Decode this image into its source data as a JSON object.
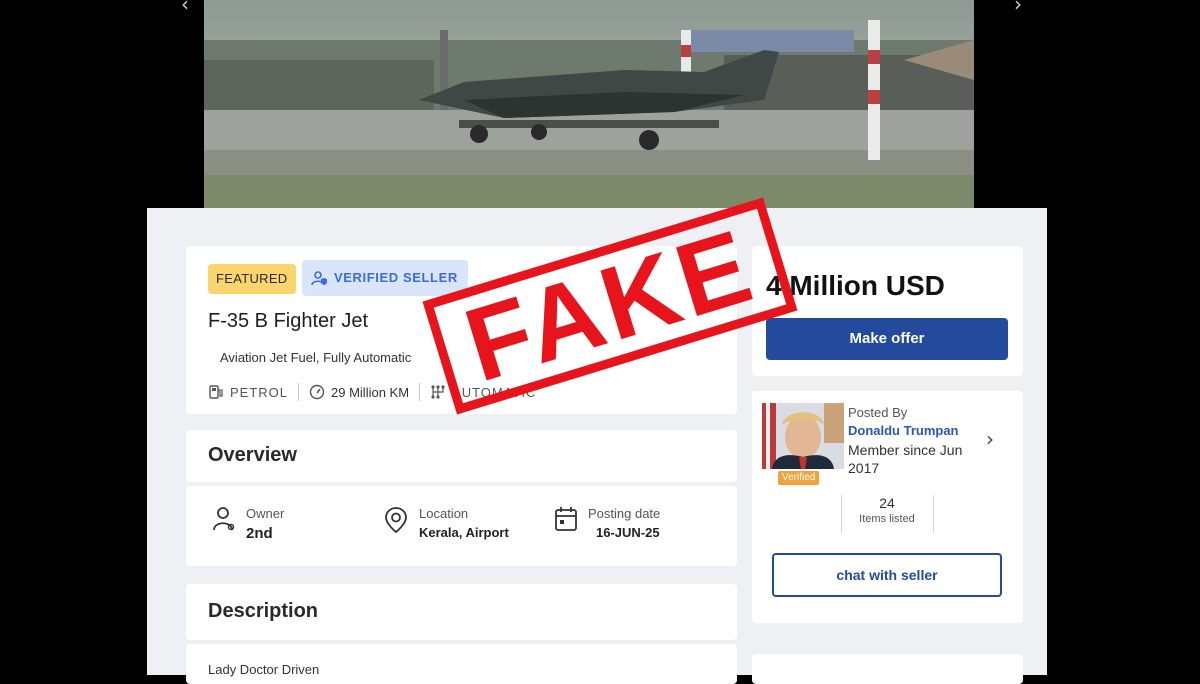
{
  "listing": {
    "badge_featured": "FEATURED",
    "badge_verified": "VERIFIED SELLER",
    "title": "F-35 B Fighter Jet",
    "subtitle": "Aviation Jet Fuel, Fully Automatic",
    "specs": {
      "fuel": "PETROL",
      "km": "29 Million KM",
      "transmission": "AUTOMATIC"
    }
  },
  "overview": {
    "heading": "Overview",
    "owner_label": "Owner",
    "owner_value": "2nd",
    "location_label": "Location",
    "location_value": "Kerala, Airport",
    "posting_label": "Posting date",
    "posting_value": "16-JUN-25"
  },
  "description": {
    "heading": "Description",
    "text": "Lady Doctor Driven"
  },
  "price": {
    "amount": "4 Million USD",
    "make_offer": "Make offer"
  },
  "seller": {
    "posted_by": "Posted By",
    "name": "Donaldu Trumpan",
    "member_since": "Member since Jun 2017",
    "verified": "Verified",
    "items_count": "24",
    "items_label": "Items listed",
    "chat_button": "chat with seller"
  },
  "overlay": {
    "stamp": "FAKE"
  },
  "colors": {
    "primary": "#234a9c",
    "stamp_red": "#e8141b",
    "featured_yellow": "#f9d56b",
    "verified_bg": "#d9e5fb"
  },
  "icons": [
    "fuel-pump-icon",
    "speedometer-icon",
    "transmission-icon",
    "user-icon",
    "location-pin-icon",
    "calendar-icon",
    "chevron-right-icon",
    "shield-user-icon"
  ]
}
